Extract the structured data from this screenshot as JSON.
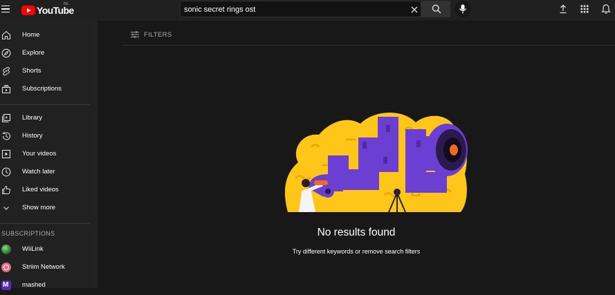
{
  "header": {
    "logo_text": "YouTube",
    "country_code": "NL",
    "search": {
      "value": "sonic secret rings ost",
      "placeholder": "Search"
    }
  },
  "sidebar": {
    "items": [
      {
        "label": "Home",
        "icon": "home-icon"
      },
      {
        "label": "Explore",
        "icon": "compass-icon"
      },
      {
        "label": "Shorts",
        "icon": "shorts-icon"
      },
      {
        "label": "Subscriptions",
        "icon": "subscriptions-icon"
      }
    ],
    "library_items": [
      {
        "label": "Library",
        "icon": "library-icon"
      },
      {
        "label": "History",
        "icon": "history-icon"
      },
      {
        "label": "Your videos",
        "icon": "play-square-icon"
      },
      {
        "label": "Watch later",
        "icon": "clock-icon"
      },
      {
        "label": "Liked videos",
        "icon": "thumbs-up-icon"
      },
      {
        "label": "Show more",
        "icon": "chevron-down-icon"
      }
    ],
    "subscriptions_title": "SUBSCRIPTIONS",
    "subscriptions": [
      {
        "label": "WiiLink",
        "color": "#3a9d4a"
      },
      {
        "label": "Striim Network",
        "color": "#e9698a"
      },
      {
        "label": "mashed",
        "color": "#5b2bb8"
      }
    ]
  },
  "main": {
    "filters_label": "FILTERS",
    "no_results_title": "No results found",
    "no_results_hint": "Try different keywords or remove search filters"
  },
  "colors": {
    "illustration_yellow": "#ffc61a",
    "illustration_purple": "#6b3fd1",
    "accent_red": "#ff0000",
    "lens_orange": "#f26b1d"
  }
}
